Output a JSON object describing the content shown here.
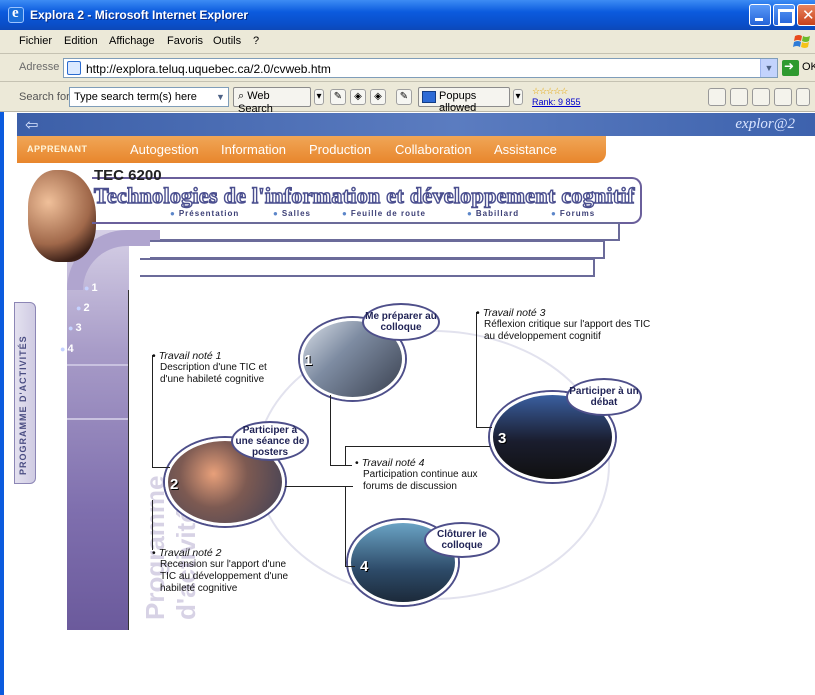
{
  "window": {
    "title": "Explora 2 - Microsoft Internet Explorer"
  },
  "menu": [
    "Fichier",
    "Edition",
    "Affichage",
    "Favoris",
    "Outils",
    "?"
  ],
  "address": {
    "label": "Adresse",
    "url": "http://explora.teluq.uquebec.ca/2.0/cvweb.htm",
    "go_label": "OK"
  },
  "search_toolbar": {
    "label": "Search for",
    "placeholder": "Type search term(s) here",
    "web_search": "Web Search",
    "popups": "Popups allowed",
    "rank": "Rank: 9 855"
  },
  "site": {
    "brand": "explor@2",
    "nav_role": "APPRENANT",
    "nav": [
      "Autogestion",
      "Information",
      "Production",
      "Collaboration",
      "Assistance"
    ]
  },
  "course": {
    "code": "TEC 6200",
    "title": "Technologies de l'information et développement cognitif",
    "submenu": [
      "Présentation",
      "Salles",
      "Feuille de route",
      "Babillard",
      "Forums"
    ]
  },
  "sidebar": {
    "tab_label": "PROGRAMME D'ACTIVITÉS",
    "items": [
      "1",
      "2",
      "3",
      "4"
    ],
    "watermark": "Programme d'activités"
  },
  "activities": [
    {
      "num": "1",
      "label": "Me préparer au colloque"
    },
    {
      "num": "2",
      "label": "Participer à une séance de posters"
    },
    {
      "num": "3",
      "label": "Participer à un débat"
    },
    {
      "num": "4",
      "label": "Clôturer le colloque"
    }
  ],
  "notes": [
    {
      "title": "Travail noté 1",
      "text": "Description d'une TIC et d'une habileté cognitive"
    },
    {
      "title": "Travail noté 2",
      "text": "Recension sur l'apport d'une TIC au développement d'une habileté cognitive"
    },
    {
      "title": "Travail noté 3",
      "text": "Réflexion critique sur l'apport des TIC au développement cognitif"
    },
    {
      "title": "Travail noté 4",
      "text": "Participation continue aux forums de discussion"
    }
  ],
  "colors": {
    "xp_blue": "#0b5bde",
    "nav_orange": "#e8862c",
    "purple": "#7f6fae",
    "title_outline": "#4b4f8f"
  }
}
